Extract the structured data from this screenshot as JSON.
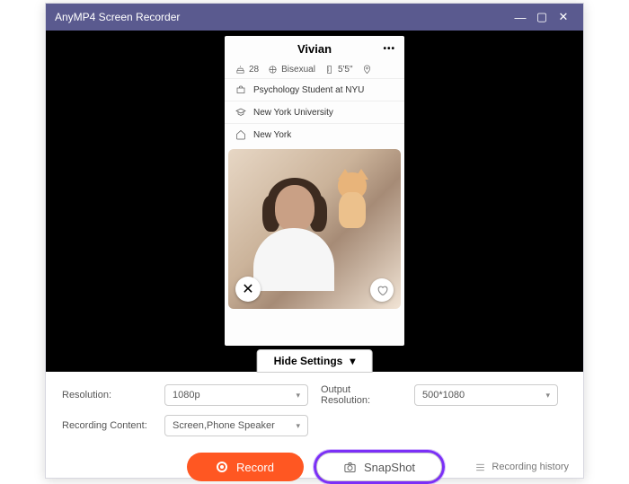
{
  "titlebar": {
    "title": "AnyMP4 Screen Recorder"
  },
  "profile": {
    "name": "Vivian",
    "age": "28",
    "orientation": "Bisexual",
    "height": "5'5\"",
    "occupation": "Psychology Student at NYU",
    "school": "New York University",
    "city": "New York"
  },
  "hide_settings_label": "Hide Settings",
  "settings": {
    "resolution_label": "Resolution:",
    "resolution_value": "1080p",
    "output_resolution_label": "Output Resolution:",
    "output_resolution_value": "500*1080",
    "recording_content_label": "Recording Content:",
    "recording_content_value": "Screen,Phone Speaker"
  },
  "actions": {
    "record_label": "Record",
    "snapshot_label": "SnapShot",
    "history_label": "Recording history"
  },
  "colors": {
    "titlebar": "#5a5a8f",
    "record": "#ff5722",
    "highlight": "#7b2ff7"
  }
}
